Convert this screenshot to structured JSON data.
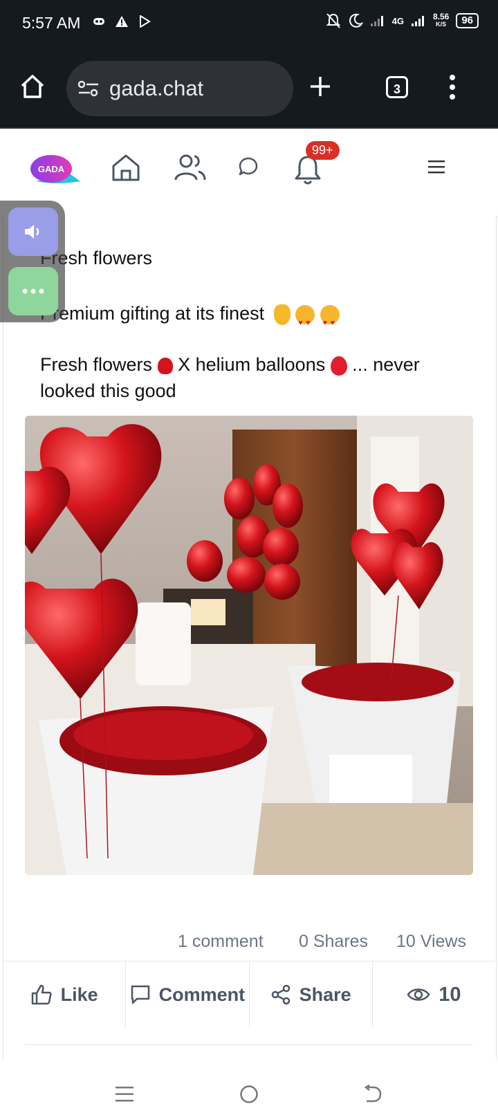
{
  "status": {
    "time": "5:57 AM",
    "network": "4G",
    "speed": "8.56",
    "speed_unit": "K/S",
    "battery": "96"
  },
  "browser": {
    "url": "gada.chat",
    "tab_count": "3"
  },
  "app": {
    "logo_text": "GADA",
    "notif_badge": "99+"
  },
  "post": {
    "line1": "Fresh flowers",
    "line2": "Premium gifting at its finest",
    "line3a": "Fresh flowers",
    "line3b": "X helium balloons",
    "line3c": "... never looked this good",
    "stats": {
      "comments": "1 comment",
      "shares": "0 Shares",
      "views": "10 Views"
    },
    "actions": {
      "like": "Like",
      "comment": "Comment",
      "share": "Share",
      "views": "10"
    }
  },
  "colors": {
    "status_bg": "#151a21",
    "badge": "#d93025",
    "logo_a": "#8b3ee8",
    "logo_b": "#1fc7e0",
    "balloon": "#d4141c"
  }
}
